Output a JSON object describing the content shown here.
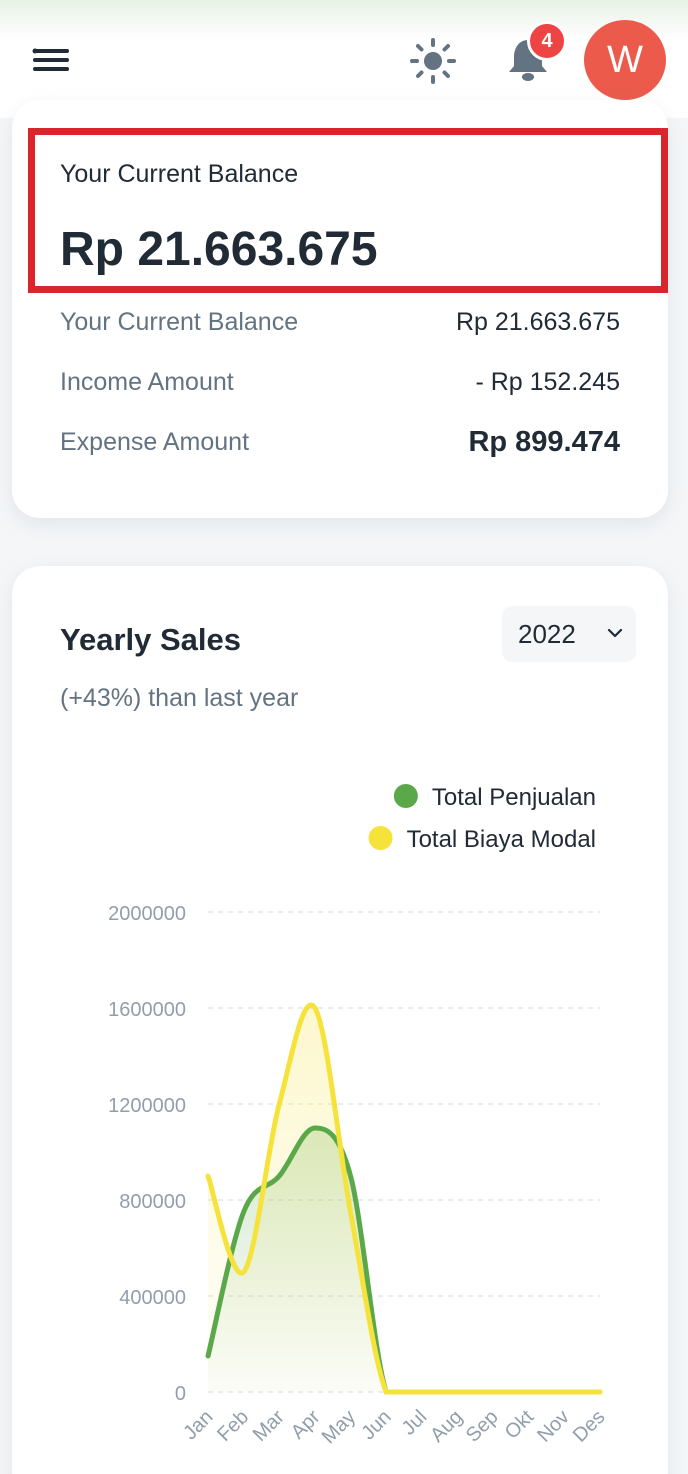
{
  "header": {
    "menu_icon": "hamburger-menu-icon",
    "theme_icon": "sun-icon",
    "notification_icon": "bell-icon",
    "notification_count": "4",
    "avatar_initial": "W",
    "avatar_color": "#eb5a4b",
    "badge_color": "#ef4444"
  },
  "balance": {
    "highlight_label": "Your Current Balance",
    "highlight_amount": "Rp 21.663.675",
    "rows": [
      {
        "label": "Your Current Balance",
        "value": "Rp 21.663.675"
      },
      {
        "label": "Income Amount",
        "value": "- Rp 152.245"
      },
      {
        "label": "Expense Amount",
        "value": "Rp 899.474"
      }
    ]
  },
  "sales": {
    "title": "Yearly Sales",
    "subtitle": "(+43%) than last year",
    "year_selected": "2022"
  },
  "chart_data": {
    "type": "area",
    "categories": [
      "Jan",
      "Feb",
      "Mar",
      "Apr",
      "May",
      "Jun",
      "Jul",
      "Aug",
      "Sep",
      "Okt",
      "Nov",
      "Des"
    ],
    "series": [
      {
        "name": "Total Penjualan",
        "color": "#5ba84a",
        "values": [
          150000,
          750000,
          900000,
          1100000,
          900000,
          0,
          0,
          0,
          0,
          0,
          0,
          0
        ]
      },
      {
        "name": "Total Biaya Modal",
        "color": "#f5e23b",
        "values": [
          900000,
          500000,
          1200000,
          1600000,
          750000,
          0,
          0,
          0,
          0,
          0,
          0,
          0
        ]
      }
    ],
    "yticks": [
      "0",
      "400000",
      "800000",
      "1200000",
      "1600000",
      "2000000"
    ],
    "ylim": [
      0,
      2000000
    ],
    "grid": true,
    "legend": "top-right"
  }
}
